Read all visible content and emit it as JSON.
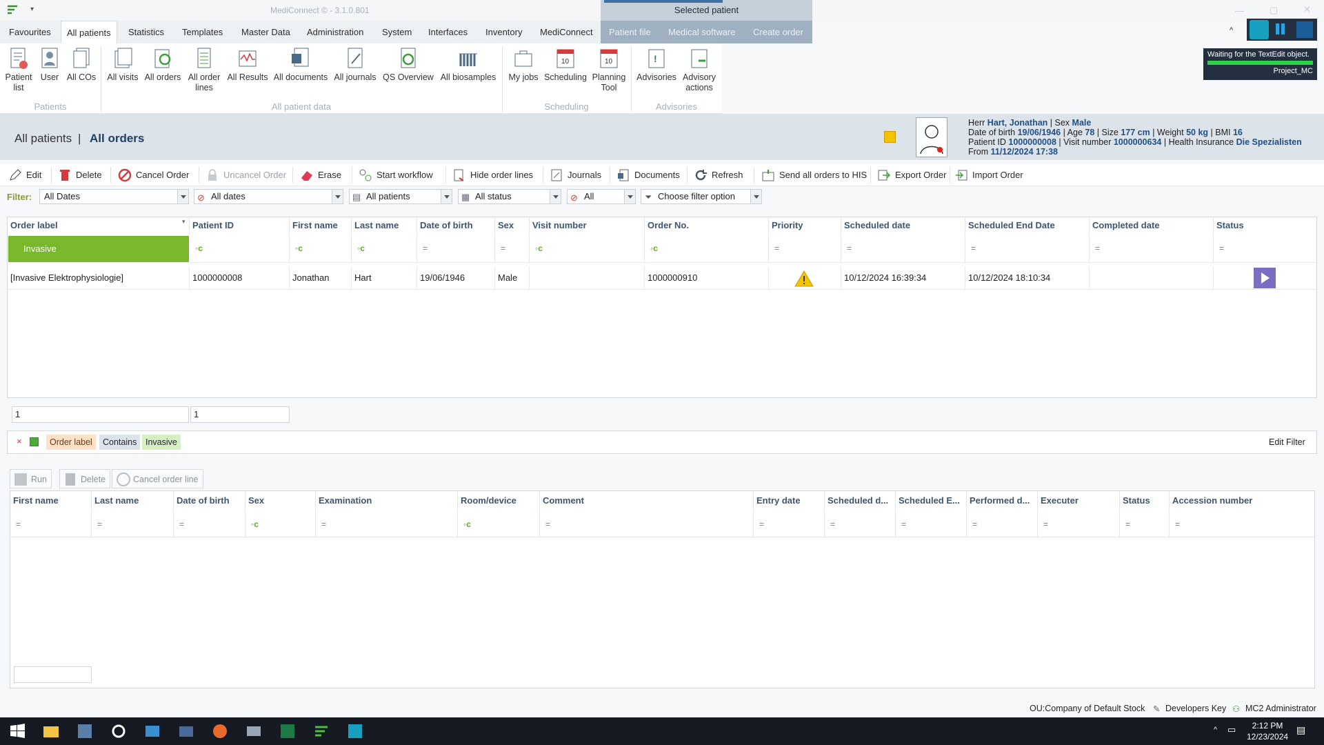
{
  "app": {
    "title": "MediConnect © - 3.1.0.801",
    "selected_patient": "Selected patient"
  },
  "menu": {
    "items": [
      "Favourites",
      "All patients",
      "Statistics",
      "Templates",
      "Master Data",
      "Administration",
      "System",
      "Interfaces",
      "Inventory",
      "MediConnect"
    ],
    "context_items": [
      "Patient file",
      "Medical software",
      "Create order"
    ]
  },
  "ribbon": {
    "patients": [
      "Patient list",
      "User",
      "All COs"
    ],
    "all_patient_data": [
      "All visits",
      "All orders",
      "All order lines",
      "All Results",
      "All documents",
      "All journals",
      "QS Overview",
      "All biosamples"
    ],
    "scheduling": [
      "My jobs",
      "Scheduling",
      "Planning Tool"
    ],
    "advisories": [
      "Advisories",
      "Advisory actions"
    ],
    "groups": [
      "Patients",
      "All patient data",
      "Scheduling",
      "Advisories"
    ]
  },
  "tooltip": {
    "text": "Waiting for the TextEdit object.",
    "project": "Project_MC"
  },
  "breadcrumb": {
    "parent": "All patients",
    "sep": "|",
    "current": "All orders"
  },
  "patient": {
    "salutation": "Herr",
    "name": "Hart, Jonathan",
    "sex_label": "| Sex",
    "sex": "Male",
    "dob_label": "Date of birth",
    "dob": "19/06/1946",
    "age_label": "| Age",
    "age": "78",
    "size_label": "| Size",
    "size": "177 cm",
    "weight_label": "| Weight",
    "weight": "50 kg",
    "bmi_label": "| BMI",
    "bmi": "16",
    "pid_label": "Patient ID",
    "pid": "1000000008",
    "visit_label": "| Visit number",
    "visit": "1000000634",
    "ins_label": "| Health Insurance",
    "insurance": "Die Spezialisten",
    "from_label": "From",
    "from": "11/12/2024 17:38"
  },
  "toolbar": [
    "Edit",
    "Delete",
    "Cancel Order",
    "Uncancel Order",
    "Erase",
    "Start workflow",
    "Hide order lines",
    "Journals",
    "Documents",
    "Refresh",
    "Send all orders to HIS",
    "Export Order",
    "Import Order"
  ],
  "filter": {
    "label": "Filter:",
    "dates": "All Dates",
    "dates2": "All dates",
    "patients": "All patients",
    "status": "All status",
    "all": "All",
    "option": "Choose filter option"
  },
  "orders": {
    "columns": [
      "Order label",
      "Patient ID",
      "First name",
      "Last name",
      "Date of birth",
      "Sex",
      "Visit number",
      "Order No.",
      "Priority",
      "Scheduled date",
      "Scheduled End Date",
      "Completed date",
      "Status"
    ],
    "filter_label_value": "Invasive",
    "row": {
      "label": "[Invasive Elektrophysiologie]",
      "patient_id": "1000000008",
      "first": "Jonathan",
      "last": "Hart",
      "dob": "19/06/1946",
      "sex": "Male",
      "visit": "",
      "order_no": "1000000910",
      "priority": "warning",
      "scheduled": "10/12/2024 16:39:34",
      "scheduled_end": "10/12/2024 18:10:34",
      "completed": "",
      "status": "play"
    },
    "pager_a": "1",
    "pager_b": "1"
  },
  "active_filter": {
    "field": "Order label",
    "op": "Contains",
    "value": "Invasive",
    "edit": "Edit Filter"
  },
  "order_lines": {
    "buttons": [
      "Run",
      "Delete",
      "Cancel order line"
    ],
    "columns": [
      "First name",
      "Last name",
      "Date of birth",
      "Sex",
      "Examination",
      "Room/device",
      "Comment",
      "Entry date",
      "Scheduled d...",
      "Scheduled E...",
      "Performed d...",
      "Executer",
      "Status",
      "Accession number"
    ]
  },
  "statusbar": {
    "ou": "OU:Company of Default Stock",
    "key": "Developers Key",
    "user": "MC2 Administrator"
  },
  "clock": {
    "time": "2:12 PM",
    "date": "12/23/2024"
  },
  "colors": {
    "accent": "#78b82a",
    "header_bg": "#dde3ea",
    "ctx_menu": "#9fb0c1",
    "link": "#1f4f86"
  }
}
